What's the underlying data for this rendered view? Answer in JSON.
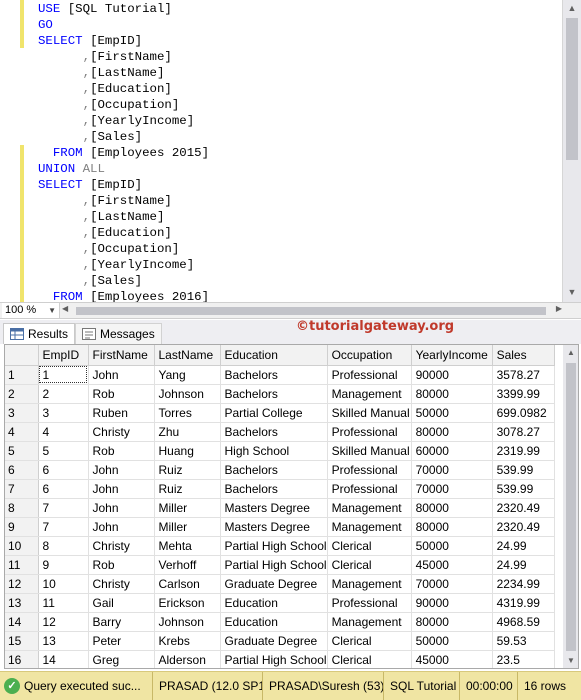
{
  "editor": {
    "lines": [
      [
        {
          "t": "USE ",
          "c": "kw"
        },
        {
          "t": "[SQL Tutorial]",
          "c": "pl"
        }
      ],
      [
        {
          "t": "GO",
          "c": "kw"
        }
      ],
      [
        {
          "t": "SELECT ",
          "c": "kw"
        },
        {
          "t": "[EmpID]",
          "c": "pl"
        }
      ],
      [
        {
          "t": "      ,",
          "c": "gr"
        },
        {
          "t": "[FirstName]",
          "c": "pl"
        }
      ],
      [
        {
          "t": "      ,",
          "c": "gr"
        },
        {
          "t": "[LastName]",
          "c": "pl"
        }
      ],
      [
        {
          "t": "      ,",
          "c": "gr"
        },
        {
          "t": "[Education]",
          "c": "pl"
        }
      ],
      [
        {
          "t": "      ,",
          "c": "gr"
        },
        {
          "t": "[Occupation]",
          "c": "pl"
        }
      ],
      [
        {
          "t": "      ,",
          "c": "gr"
        },
        {
          "t": "[YearlyIncome]",
          "c": "pl"
        }
      ],
      [
        {
          "t": "      ,",
          "c": "gr"
        },
        {
          "t": "[Sales]",
          "c": "pl"
        }
      ],
      [
        {
          "t": "  FROM ",
          "c": "kw"
        },
        {
          "t": "[Employees 2015]",
          "c": "pl"
        }
      ],
      [
        {
          "t": "UNION ",
          "c": "kw"
        },
        {
          "t": "ALL",
          "c": "gr"
        }
      ],
      [
        {
          "t": "SELECT ",
          "c": "kw"
        },
        {
          "t": "[EmpID]",
          "c": "pl"
        }
      ],
      [
        {
          "t": "      ,",
          "c": "gr"
        },
        {
          "t": "[FirstName]",
          "c": "pl"
        }
      ],
      [
        {
          "t": "      ,",
          "c": "gr"
        },
        {
          "t": "[LastName]",
          "c": "pl"
        }
      ],
      [
        {
          "t": "      ,",
          "c": "gr"
        },
        {
          "t": "[Education]",
          "c": "pl"
        }
      ],
      [
        {
          "t": "      ,",
          "c": "gr"
        },
        {
          "t": "[Occupation]",
          "c": "pl"
        }
      ],
      [
        {
          "t": "      ,",
          "c": "gr"
        },
        {
          "t": "[YearlyIncome]",
          "c": "pl"
        }
      ],
      [
        {
          "t": "      ,",
          "c": "gr"
        },
        {
          "t": "[Sales]",
          "c": "pl"
        }
      ],
      [
        {
          "t": "  FROM ",
          "c": "kw"
        },
        {
          "t": "[Employees 2016]",
          "c": "pl"
        }
      ]
    ],
    "zoom": "100 %"
  },
  "results": {
    "tabs": {
      "results": "Results",
      "messages": "Messages"
    },
    "brand": "©tutorialgateway.org",
    "columns": [
      "EmpID",
      "FirstName",
      "LastName",
      "Education",
      "Occupation",
      "YearlyIncome",
      "Sales"
    ],
    "rows": [
      [
        "1",
        "John",
        "Yang",
        "Bachelors",
        "Professional",
        "90000",
        "3578.27"
      ],
      [
        "2",
        "Rob",
        "Johnson",
        "Bachelors",
        "Management",
        "80000",
        "3399.99"
      ],
      [
        "3",
        "Ruben",
        "Torres",
        "Partial College",
        "Skilled Manual",
        "50000",
        "699.0982"
      ],
      [
        "4",
        "Christy",
        "Zhu",
        "Bachelors",
        "Professional",
        "80000",
        "3078.27"
      ],
      [
        "5",
        "Rob",
        "Huang",
        "High School",
        "Skilled Manual",
        "60000",
        "2319.99"
      ],
      [
        "6",
        "John",
        "Ruiz",
        "Bachelors",
        "Professional",
        "70000",
        "539.99"
      ],
      [
        "6",
        "John",
        "Ruiz",
        "Bachelors",
        "Professional",
        "70000",
        "539.99"
      ],
      [
        "7",
        "John",
        "Miller",
        "Masters Degree",
        "Management",
        "80000",
        "2320.49"
      ],
      [
        "7",
        "John",
        "Miller",
        "Masters Degree",
        "Management",
        "80000",
        "2320.49"
      ],
      [
        "8",
        "Christy",
        "Mehta",
        "Partial High School",
        "Clerical",
        "50000",
        "24.99"
      ],
      [
        "9",
        "Rob",
        "Verhoff",
        "Partial High School",
        "Clerical",
        "45000",
        "24.99"
      ],
      [
        "10",
        "Christy",
        "Carlson",
        "Graduate Degree",
        "Management",
        "70000",
        "2234.99"
      ],
      [
        "11",
        "Gail",
        "Erickson",
        "Education",
        "Professional",
        "90000",
        "4319.99"
      ],
      [
        "12",
        "Barry",
        "Johnson",
        "Education",
        "Management",
        "80000",
        "4968.59"
      ],
      [
        "13",
        "Peter",
        "Krebs",
        "Graduate Degree",
        "Clerical",
        "50000",
        "59.53"
      ],
      [
        "14",
        "Greg",
        "Alderson",
        "Partial High School",
        "Clerical",
        "45000",
        "23.5"
      ]
    ]
  },
  "status": {
    "message": "Query executed suc...",
    "server": "PRASAD (12.0 SP1)",
    "user": "PRASAD\\Suresh (53)",
    "database": "SQL Tutorial",
    "elapsed": "00:00:00",
    "rows": "16 rows"
  },
  "colors": {
    "keyword": "#0000ff",
    "gray_text": "#808080",
    "change_marker": "#f0e46c",
    "status_bar": "#f0e5a3",
    "brand": "#c0392b"
  }
}
